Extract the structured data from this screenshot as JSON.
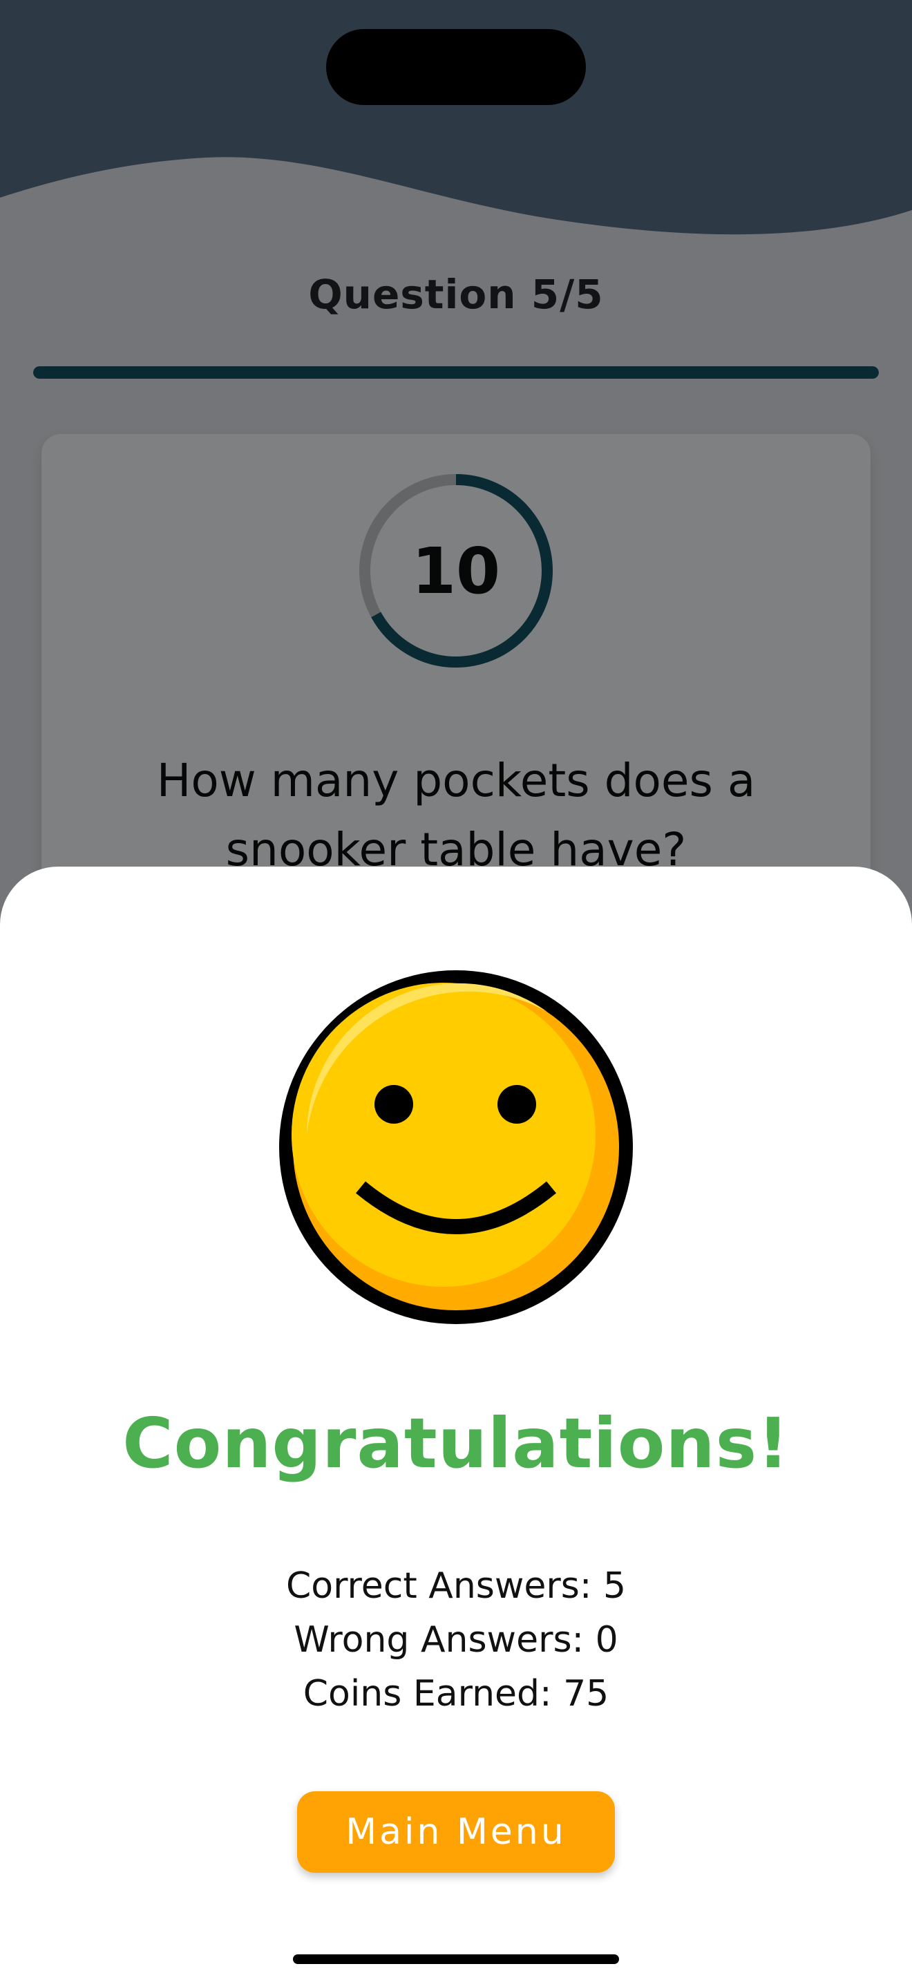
{
  "quiz": {
    "question_counter": "Question 5/5",
    "progress_fraction": 1.0,
    "timer": {
      "value": "10",
      "fraction_remaining": 0.67
    },
    "question_text": "How many pockets does a snooker table have?"
  },
  "result_sheet": {
    "icon": "smiley-face-icon",
    "title": "Congratulations!",
    "stats": {
      "correct": "Correct Answers: 5",
      "wrong": "Wrong Answers: 0",
      "coins": "Coins Earned: 75"
    },
    "main_menu_label": "Main Menu"
  },
  "colors": {
    "accent_teal": "#124e5e",
    "success_green": "#4caf50",
    "button_orange": "#ffa305",
    "header_slate": "#556880",
    "smiley_yellow": "#ffcc00"
  }
}
